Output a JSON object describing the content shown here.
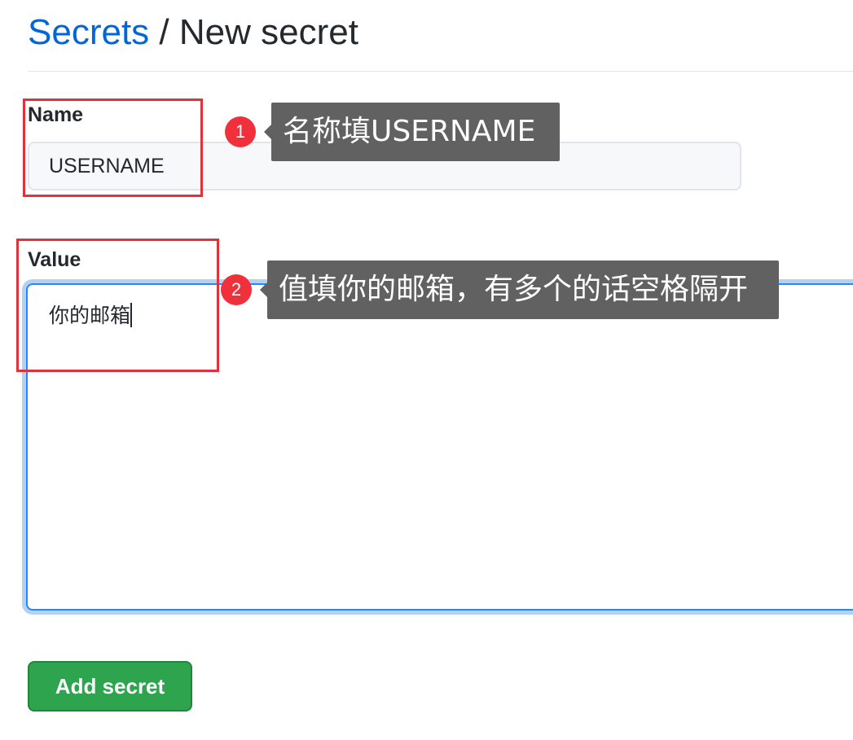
{
  "breadcrumb": {
    "parent": "Secrets",
    "separator": "/",
    "current": "New secret"
  },
  "form": {
    "name_label": "Name",
    "name_value": "USERNAME",
    "value_label": "Value",
    "value_text": "你的邮箱",
    "submit_label": "Add secret"
  },
  "annotations": [
    {
      "number": "1",
      "text": "名称填USERNAME"
    },
    {
      "number": "2",
      "text": "值填你的邮箱，有多个的话空格隔开"
    }
  ],
  "colors": {
    "link": "#0366d6",
    "primary_button": "#2ea44f",
    "annotation_box": "#e0323b",
    "annotation_badge": "#f0303a",
    "tooltip_bg": "#616161",
    "focus_border": "#2188ff"
  }
}
